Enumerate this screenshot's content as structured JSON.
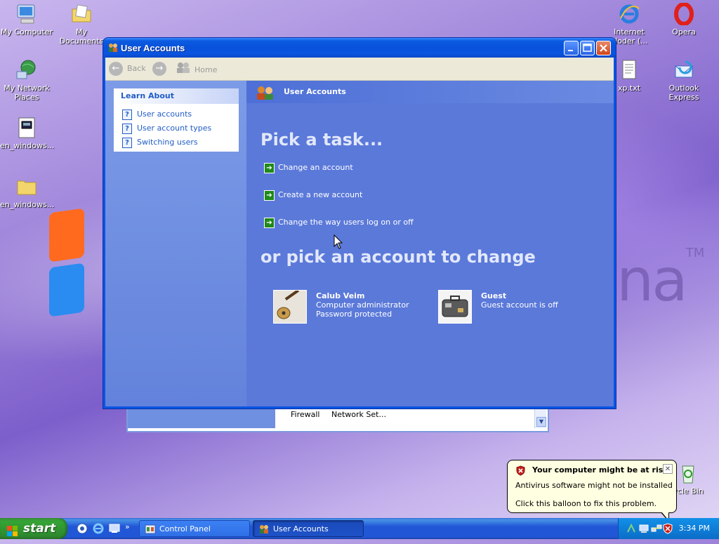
{
  "desktop": {
    "icons_left": [
      {
        "name": "My Computer"
      },
      {
        "name": "My Documents"
      },
      {
        "name": "My Network Places"
      },
      {
        "name": "en_windows..."
      },
      {
        "name": "en_windows..."
      }
    ],
    "icons_right": [
      {
        "name": "Internet Ploder (..."
      },
      {
        "name": "Opera"
      },
      {
        "name": "xp.txt"
      },
      {
        "name": "Outlook Express"
      },
      {
        "name": "ycle Bin"
      }
    ],
    "wallpaper_text": "na",
    "wallpaper_tm": "TM"
  },
  "background_window": {
    "cells": [
      "Firewall",
      "Network Set..."
    ]
  },
  "window": {
    "title": "User Accounts",
    "toolbar": {
      "back_label": "Back",
      "home_label": "Home"
    },
    "learn_about": {
      "heading": "Learn About",
      "items": [
        "User accounts",
        "User account types",
        "Switching users"
      ]
    },
    "header": "User Accounts",
    "pick_task_heading": "Pick a task...",
    "tasks": [
      "Change an account",
      "Create a new account",
      "Change the way users log on or off"
    ],
    "pick_account_heading": "or pick an account to change",
    "accounts": [
      {
        "name": "Calub Veim",
        "lines": [
          "Computer administrator",
          "Password protected"
        ]
      },
      {
        "name": "Guest",
        "lines": [
          "Guest account is off"
        ]
      }
    ]
  },
  "taskbar": {
    "start_label": "start",
    "buttons": [
      "Control Panel",
      "User Accounts"
    ],
    "clock": "3:34 PM"
  },
  "balloon": {
    "title": "Your computer might be at risk",
    "line1": "Antivirus software might not be installed",
    "line2": "Click this balloon to fix this problem."
  },
  "colors": {
    "titlebar": "#0a55e0",
    "pane": "#5b79d9",
    "link": "#215dc6",
    "start_green": "#34a334"
  }
}
